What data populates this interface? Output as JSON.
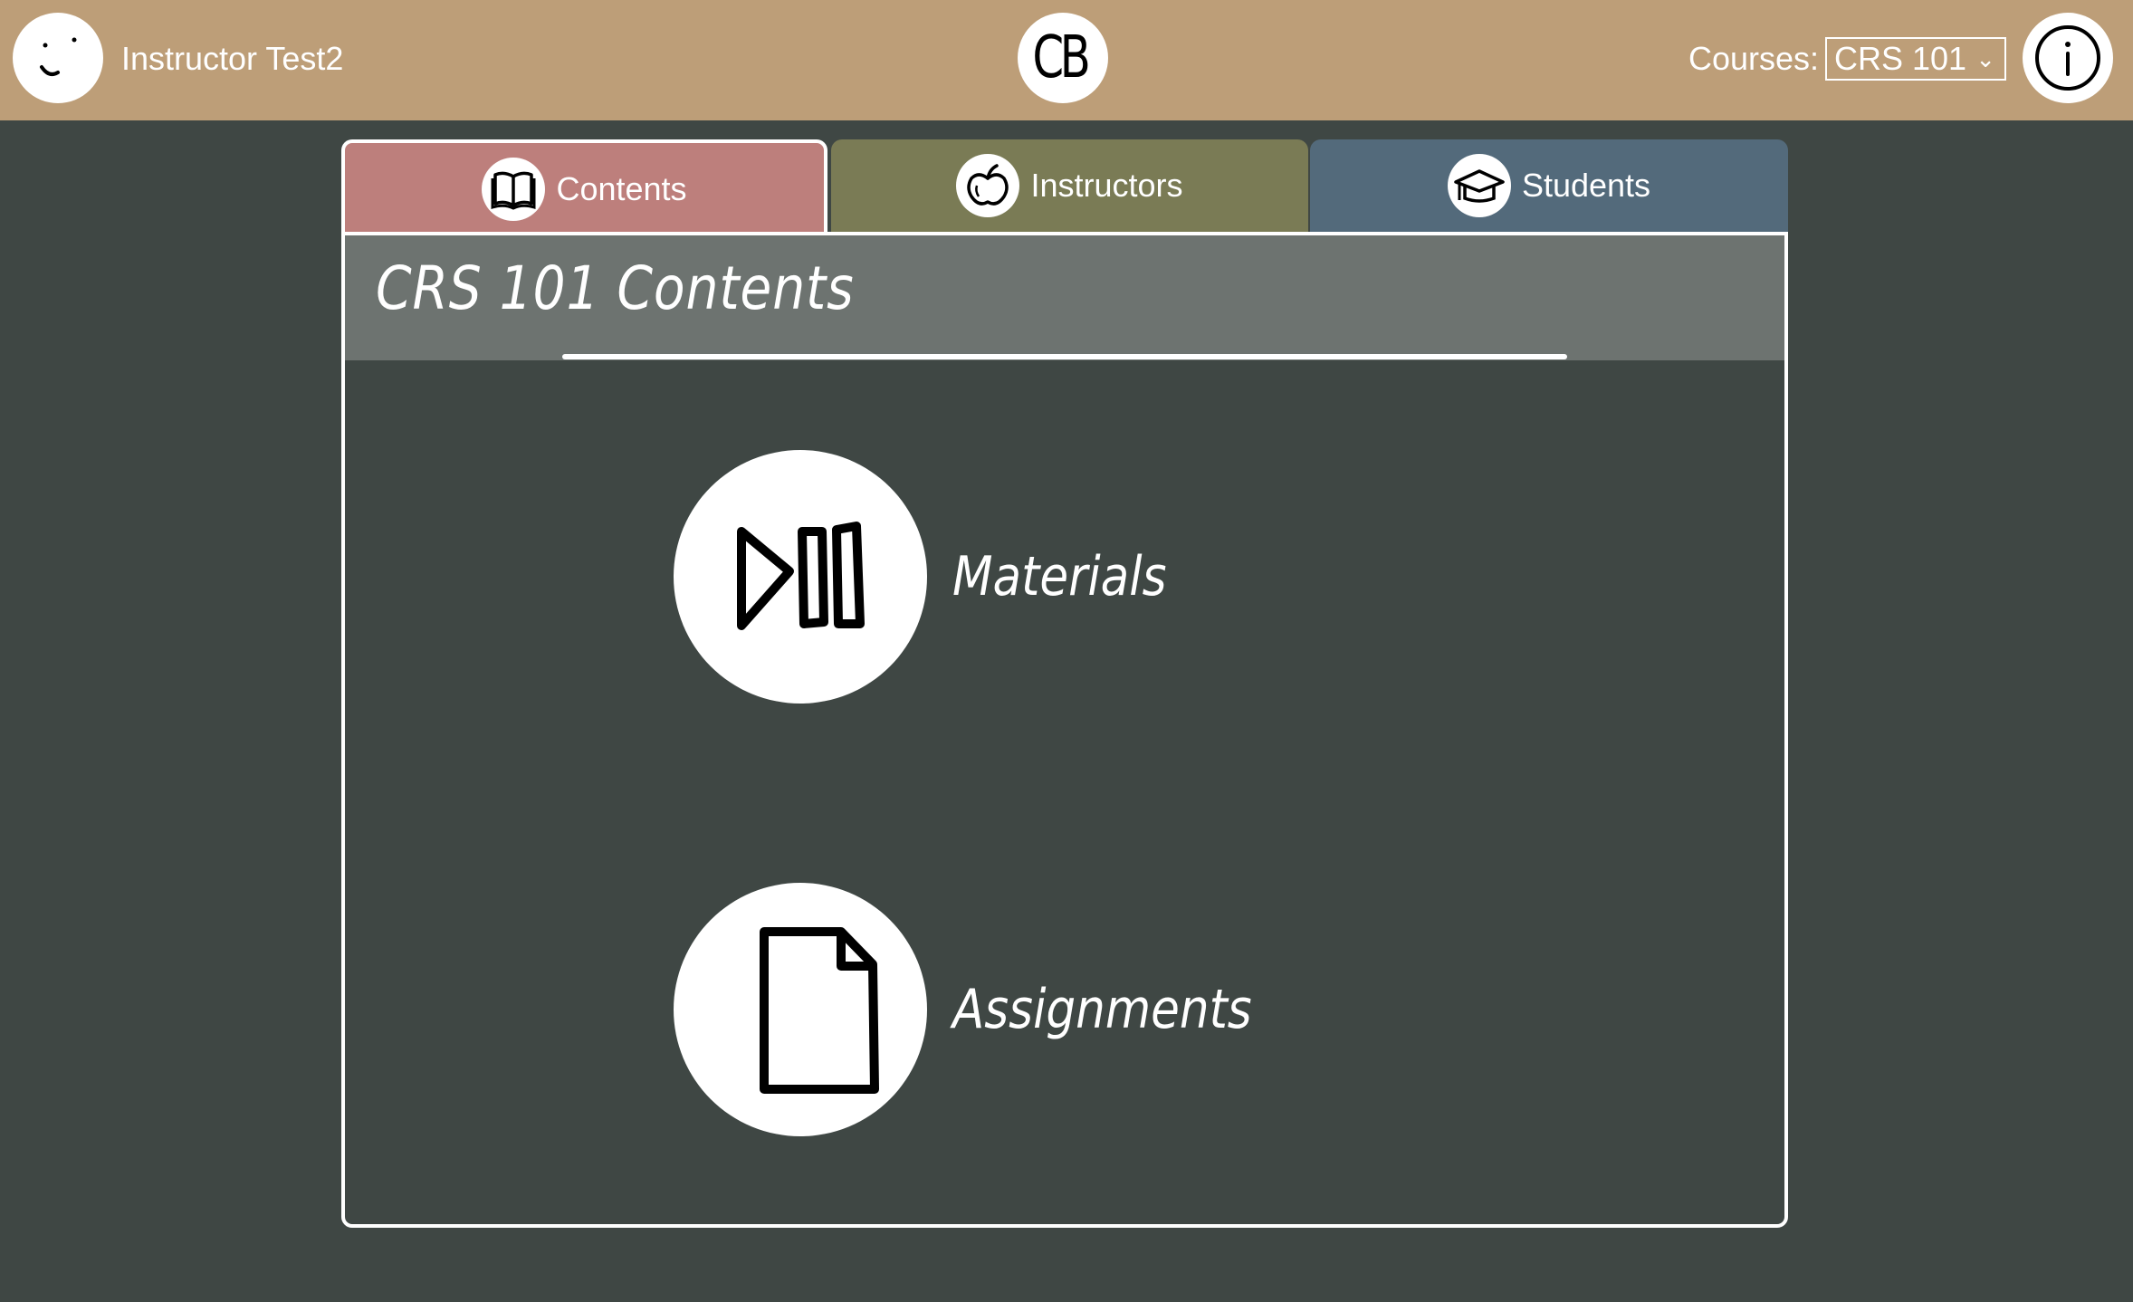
{
  "header": {
    "user_name": "Instructor Test2",
    "logo_text": "CB",
    "courses_label": "Courses:",
    "selected_course": "CRS 101",
    "avatar_icon": "smiley-face-icon",
    "info_icon": "info-icon"
  },
  "tabs": [
    {
      "label": "Contents",
      "icon": "open-book-icon",
      "color": "#bd7f7c",
      "active": true
    },
    {
      "label": "Instructors",
      "icon": "apple-icon",
      "color": "#7a7b55",
      "active": false
    },
    {
      "label": "Students",
      "icon": "graduation-cap-icon",
      "color": "#536a7b",
      "active": false
    }
  ],
  "panel": {
    "title": "CRS 101 Contents",
    "items": [
      {
        "label": "Materials",
        "icon": "play-pause-icon"
      },
      {
        "label": "Assignments",
        "icon": "document-icon"
      }
    ]
  },
  "colors": {
    "header_bg": "#bd9e78",
    "page_bg": "#3f4744",
    "panel_header_bg": "#6d7370"
  }
}
